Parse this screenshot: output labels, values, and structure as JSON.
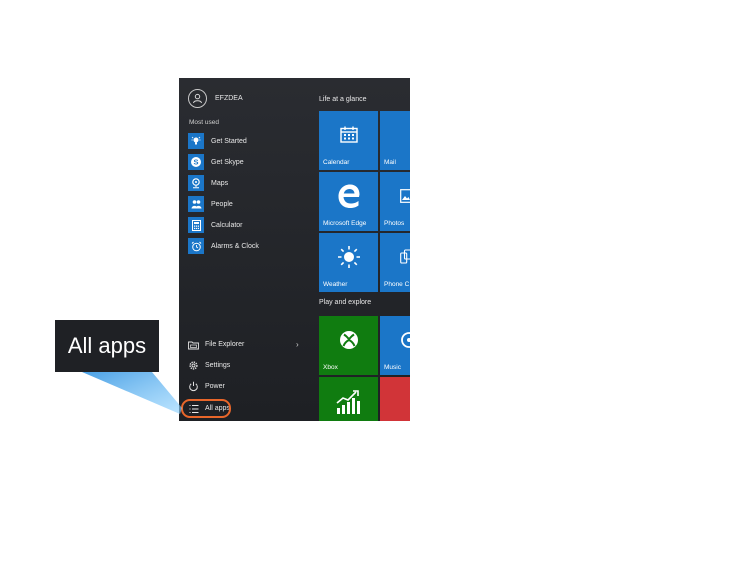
{
  "user": {
    "name": "EFZDEA",
    "icon": "person-icon"
  },
  "most_used": {
    "label": "Most used",
    "items": [
      {
        "label": "Get Started",
        "icon": "lightbulb-icon"
      },
      {
        "label": "Get Skype",
        "icon": "skype-icon"
      },
      {
        "label": "Maps",
        "icon": "maps-icon"
      },
      {
        "label": "People",
        "icon": "people-icon"
      },
      {
        "label": "Calculator",
        "icon": "calculator-icon"
      },
      {
        "label": "Alarms & Clock",
        "icon": "alarm-clock-icon"
      }
    ]
  },
  "bottom": {
    "file_explorer": "File Explorer",
    "settings": "Settings",
    "power": "Power",
    "all_apps": "All apps"
  },
  "groups": {
    "life": "Life at a glance",
    "play": "Play and explore"
  },
  "tiles": {
    "calendar": "Calendar",
    "mail": "Mail",
    "edge": "Microsoft Edge",
    "photos": "Photos",
    "weather": "Weather",
    "phone": "Phone C",
    "xbox": "Xbox",
    "music": "Music"
  },
  "callout": {
    "text": "All apps"
  },
  "colors": {
    "tile_blue": "#1b76c8",
    "tile_green": "#107c10",
    "tile_red": "#d13438",
    "highlight": "#e8662a"
  }
}
